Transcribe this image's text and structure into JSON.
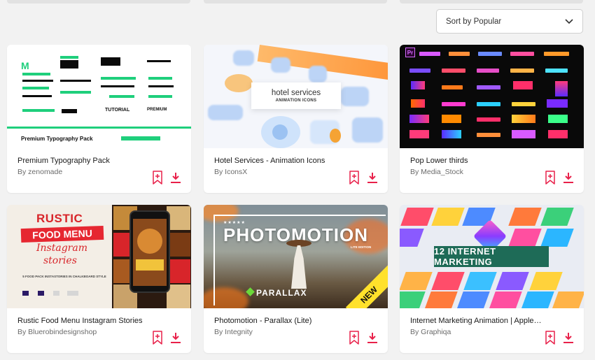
{
  "sort": {
    "label": "Sort by Popular"
  },
  "cards": [
    {
      "title": "Premium Typography Pack",
      "author": "By zenomade",
      "thumb": {
        "logo_letter": "M",
        "pack_title": "Premium Typography Pack",
        "tutorial": "TUTORIAL",
        "premium": "PREMIUM"
      }
    },
    {
      "title": "Hotel Services - Animation Icons",
      "author": "By IconsX",
      "thumb": {
        "heading": "hotel services",
        "subheading": "ANIMATION ICONS"
      }
    },
    {
      "title": "Pop Lower thirds",
      "author": "By Media_Stock",
      "thumb": {
        "badge": "Pr"
      }
    },
    {
      "title": "Rustic Food Menu Instagram Stories",
      "author": "By Bluerobindesignshop",
      "thumb": {
        "rustic": "RUSTIC",
        "food_menu": "FOOD MENU",
        "instagram": "Instagram",
        "stories": "stories",
        "subtitle": "5 FOOD PACK INSTASTORIES IN CHALKBOARD STYLE"
      }
    },
    {
      "title": "Photomotion - Parallax (Lite)",
      "author": "By Integnity",
      "thumb": {
        "stars": "★★★★★",
        "brand": "PHOTOMOTION",
        "edition": "LITE EDITION",
        "parallax": "PARALLAX",
        "badge": "NEW"
      }
    },
    {
      "title": "Internet Marketing Animation | Apple Motio...",
      "author": "By Graphiqa",
      "thumb": {
        "banner": "12 INTERNET MARKETING"
      }
    }
  ],
  "colors": {
    "accent": "#e8214a",
    "green": "#1fcf7c"
  },
  "icons": {
    "bookmark": "bookmark-add-icon",
    "download": "download-icon",
    "chevron": "chevron-down-icon"
  }
}
